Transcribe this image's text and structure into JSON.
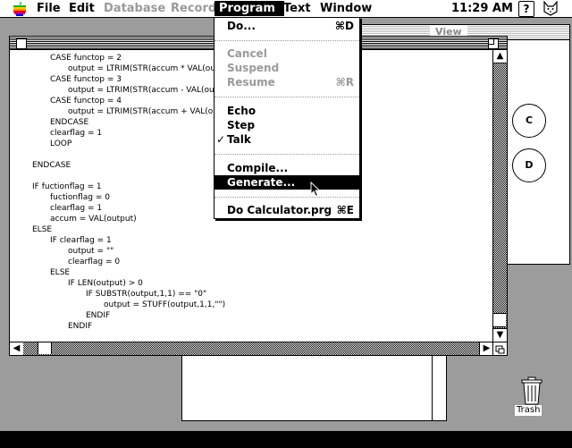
{
  "menubar": {
    "items": [
      {
        "label": "File",
        "enabled": true
      },
      {
        "label": "Edit",
        "enabled": true
      },
      {
        "label": "Database",
        "enabled": false
      },
      {
        "label": "Record",
        "enabled": false
      },
      {
        "label": "Program",
        "enabled": true,
        "active": true
      },
      {
        "label": "Text",
        "enabled": true
      },
      {
        "label": "Window",
        "enabled": true
      }
    ],
    "clock": "11:29 AM",
    "help_icon": "?"
  },
  "program_menu": {
    "items": [
      {
        "label": "Do...",
        "shortcut": "⌘D",
        "enabled": true
      },
      {
        "label": "Cancel",
        "shortcut": "",
        "enabled": false
      },
      {
        "label": "Suspend",
        "shortcut": "",
        "enabled": false
      },
      {
        "label": "Resume",
        "shortcut": "⌘R",
        "enabled": false
      },
      {
        "label": "Echo",
        "shortcut": "",
        "enabled": true
      },
      {
        "label": "Step",
        "shortcut": "",
        "enabled": true
      },
      {
        "label": "Talk",
        "shortcut": "",
        "enabled": true,
        "checked": true,
        "check": "✓"
      },
      {
        "label": "Compile...",
        "shortcut": "",
        "enabled": true
      },
      {
        "label": "Generate...",
        "shortcut": "",
        "enabled": true,
        "highlighted": true
      },
      {
        "label": "Do Calculator.prg",
        "shortcut": "⌘E",
        "enabled": true
      }
    ]
  },
  "view_window": {
    "title": "View",
    "buttons": [
      "C",
      "D"
    ]
  },
  "editor": {
    "lines": [
      "CASE functop = 2",
      "output = LTRIM(STR(accum * VAL(ou",
      "CASE functop = 3",
      "output = LTRIM(STR(accum - VAL(ou",
      "CASE functop = 4",
      "output = LTRIM(STR(accum + VAL(ou",
      "ENDCASE",
      "clearflag = 1",
      "LOOP",
      "",
      "ENDCASE",
      "",
      "IF fuctionflag = 1",
      "fuctionflag = 0",
      "clearflag = 1",
      "accum = VAL(output)",
      "ELSE",
      "IF clearflag = 1",
      "output = \"\"",
      "clearflag = 0",
      "ELSE",
      "IF LEN(output) > 0",
      "IF SUBSTR(output,1,1) == \"0\"",
      "output = STUFF(output,1,1,\"\")",
      "ENDIF",
      "ENDIF"
    ]
  },
  "desktop": {
    "trash_label": "Trash"
  },
  "icons": {
    "apple": "apple-logo-icon",
    "help": "help-icon",
    "finder": "finder-cat-icon",
    "trash": "trash-icon",
    "cursor": "arrow-cursor-icon"
  }
}
